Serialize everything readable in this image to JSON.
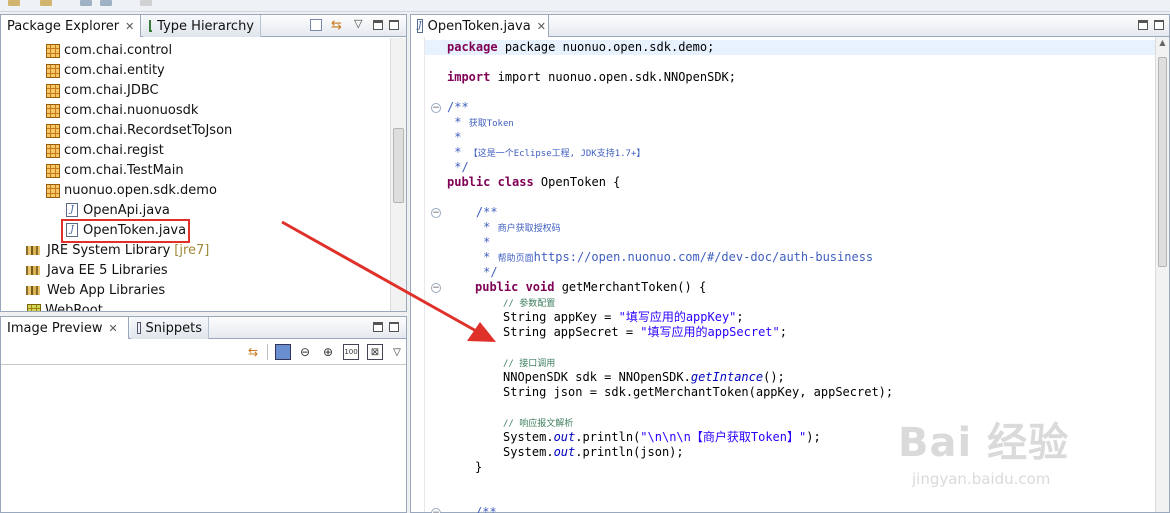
{
  "package_explorer": {
    "tabs": [
      {
        "label": "Package Explorer",
        "active": true
      },
      {
        "label": "Type Hierarchy",
        "active": false
      }
    ],
    "tree": [
      {
        "label": "com.chai.control",
        "kind": "package"
      },
      {
        "label": "com.chai.entity",
        "kind": "package"
      },
      {
        "label": "com.chai.JDBC",
        "kind": "package"
      },
      {
        "label": "com.chai.nuonuosdk",
        "kind": "package"
      },
      {
        "label": "com.chai.RecordsetToJson",
        "kind": "package"
      },
      {
        "label": "com.chai.regist",
        "kind": "package"
      },
      {
        "label": "com.chai.TestMain",
        "kind": "package"
      },
      {
        "label": "nuonuo.open.sdk.demo",
        "kind": "package"
      },
      {
        "label": "OpenApi.java",
        "kind": "java"
      },
      {
        "label": "OpenToken.java",
        "kind": "java",
        "selected": true
      },
      {
        "label": "JRE System Library",
        "decoration": "[jre7]",
        "kind": "library"
      },
      {
        "label": "Java EE 5 Libraries",
        "kind": "library"
      },
      {
        "label": "Web App Libraries",
        "kind": "library"
      },
      {
        "label": "WebRoot",
        "kind": "folder"
      }
    ]
  },
  "image_preview": {
    "tabs": [
      {
        "label": "Image Preview",
        "active": true
      },
      {
        "label": "Snippets",
        "active": false
      }
    ],
    "toolbar_icons": [
      "sync-icon",
      "fit-image-icon",
      "zoom-out-icon",
      "zoom-in-icon",
      "actual-size-icon",
      "fit-window-icon",
      "view-menu-icon"
    ]
  },
  "editor": {
    "tab_label": "OpenToken.java",
    "lines": {
      "l1": "package nuonuo.open.sdk.demo;",
      "l2": "import nuonuo.open.sdk.NNOpenSDK;",
      "l3": "/**",
      "l4a": " * ",
      "l4b": "获取Token",
      "l5": " *",
      "l6a": " * ",
      "l6b": "【这是一个Eclipse工程, JDK支持1.7+】",
      "l7": " */",
      "l8kw": "public class",
      "l8": " OpenToken {",
      "l9": "    /**",
      "l10a": "     * ",
      "l10b": "商户获取授权码",
      "l11": "     *",
      "l12a": "     * ",
      "l12b": "帮助页面",
      "l12c": "https://open.nuonuo.com/#/dev-doc/auth-business",
      "l13": "     */",
      "l14kw": "public void",
      "l14": " getMerchantToken() {",
      "l15": "// 参数配置",
      "l16a": "String appKey = ",
      "l16b": "\"填写应用的appKey\"",
      "l16c": ";",
      "l17a": "String appSecret = ",
      "l17b": "\"填写应用的appSecret\"",
      "l17c": ";",
      "l18": "// 接口调用",
      "l19a": "NNOpenSDK sdk = NNOpenSDK.",
      "l19b": "getIntance",
      "l19c": "();",
      "l20": "String json = sdk.getMerchantToken(appKey, appSecret);",
      "l21": "// 响应报文解析",
      "l22a": "System.",
      "l22b": "out",
      "l22c": ".println(",
      "l22d": "\"\\n\\n\\n【商户获取Token】\"",
      "l22e": ");",
      "l23a": "System.",
      "l23b": "out",
      "l23c": ".println(json);",
      "l24": "}",
      "l25": "/**"
    }
  },
  "watermark": {
    "main": "Bai 经验",
    "sub": "jingyan.baidu.com"
  },
  "colors": {
    "annotation_red": "#e0302a",
    "keyword": "#7f0055",
    "string": "#2a00ff",
    "comment": "#3f7f5f",
    "javadoc": "#3f5fbf"
  }
}
